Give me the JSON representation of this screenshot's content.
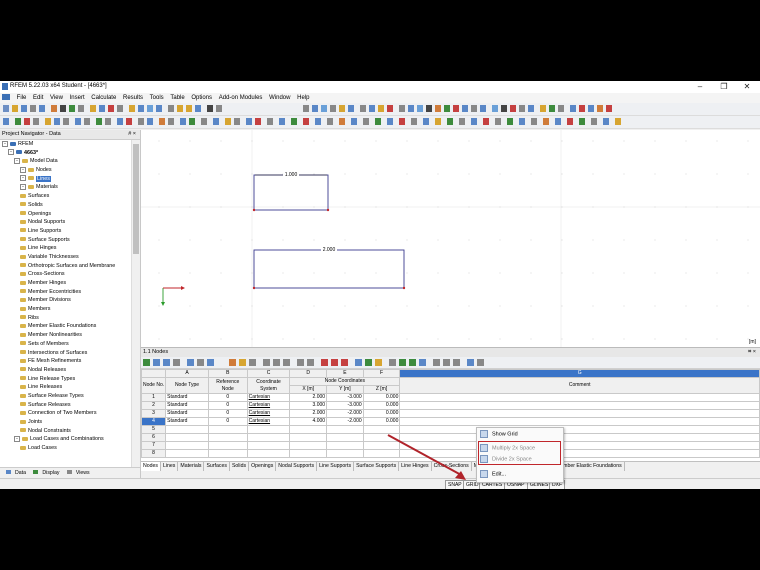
{
  "window": {
    "title": "RFEM 5.22.03 x64 Student - [4663*]",
    "controls": [
      "–",
      "❐",
      "✕"
    ]
  },
  "menu": [
    "File",
    "Edit",
    "View",
    "Insert",
    "Calculate",
    "Results",
    "Tools",
    "Table",
    "Options",
    "Add-on Modules",
    "Window",
    "Help"
  ],
  "navigator": {
    "title": "Project Navigator - Data",
    "close_symbols": "# ×",
    "items": [
      {
        "label": "RFEM",
        "indent": 0,
        "type": "root"
      },
      {
        "label": "4663*",
        "indent": 1,
        "type": "model",
        "bold": true
      },
      {
        "label": "Model Data",
        "indent": 2,
        "type": "folder-exp"
      },
      {
        "label": "Nodes",
        "indent": 3,
        "type": "folder-exp"
      },
      {
        "label": "Lines",
        "indent": 3,
        "type": "folder-exp",
        "selected": true
      },
      {
        "label": "Materials",
        "indent": 3,
        "type": "folder-exp"
      },
      {
        "label": "Surfaces",
        "indent": 3,
        "type": "folder"
      },
      {
        "label": "Solids",
        "indent": 3,
        "type": "folder"
      },
      {
        "label": "Openings",
        "indent": 3,
        "type": "folder"
      },
      {
        "label": "Nodal Supports",
        "indent": 3,
        "type": "folder"
      },
      {
        "label": "Line Supports",
        "indent": 3,
        "type": "folder"
      },
      {
        "label": "Surface Supports",
        "indent": 3,
        "type": "folder"
      },
      {
        "label": "Line Hinges",
        "indent": 3,
        "type": "folder"
      },
      {
        "label": "Variable Thicknesses",
        "indent": 3,
        "type": "folder"
      },
      {
        "label": "Orthotropic Surfaces and Membrane",
        "indent": 3,
        "type": "folder"
      },
      {
        "label": "Cross-Sections",
        "indent": 3,
        "type": "folder"
      },
      {
        "label": "Member Hinges",
        "indent": 3,
        "type": "folder"
      },
      {
        "label": "Member Eccentricities",
        "indent": 3,
        "type": "folder"
      },
      {
        "label": "Member Divisions",
        "indent": 3,
        "type": "folder"
      },
      {
        "label": "Members",
        "indent": 3,
        "type": "folder"
      },
      {
        "label": "Ribs",
        "indent": 3,
        "type": "folder"
      },
      {
        "label": "Member Elastic Foundations",
        "indent": 3,
        "type": "folder"
      },
      {
        "label": "Member Nonlinearities",
        "indent": 3,
        "type": "folder"
      },
      {
        "label": "Sets of Members",
        "indent": 3,
        "type": "folder"
      },
      {
        "label": "Intersections of Surfaces",
        "indent": 3,
        "type": "folder"
      },
      {
        "label": "FE Mesh Refinements",
        "indent": 3,
        "type": "folder"
      },
      {
        "label": "Nodal Releases",
        "indent": 3,
        "type": "folder"
      },
      {
        "label": "Line Release Types",
        "indent": 3,
        "type": "folder"
      },
      {
        "label": "Line Releases",
        "indent": 3,
        "type": "folder"
      },
      {
        "label": "Surface Release Types",
        "indent": 3,
        "type": "folder"
      },
      {
        "label": "Surface Releases",
        "indent": 3,
        "type": "folder"
      },
      {
        "label": "Connection of Two Members",
        "indent": 3,
        "type": "folder"
      },
      {
        "label": "Joints",
        "indent": 3,
        "type": "folder"
      },
      {
        "label": "Nodal Constraints",
        "indent": 3,
        "type": "folder"
      },
      {
        "label": "Load Cases and Combinations",
        "indent": 2,
        "type": "folder-exp"
      },
      {
        "label": "Load Cases",
        "indent": 3,
        "type": "folder"
      }
    ],
    "tabs": [
      "Data",
      "Display",
      "Views"
    ]
  },
  "canvas": {
    "label_top": "1.000",
    "label_bottom": "2.000",
    "corner": "[m]"
  },
  "table": {
    "title": "1.1 Nodes",
    "col_letters": [
      "A",
      "B",
      "C",
      "D",
      "E",
      "F",
      "G"
    ],
    "group_header": "Node Coordinates",
    "headers": [
      "Node No.",
      "Node Type",
      "Reference Node",
      "Coordinate System",
      "X [m]",
      "Y [m]",
      "Z [m]",
      "Comment"
    ],
    "rows": [
      [
        "1",
        "Standard",
        "0",
        "Cartesian",
        "2.000",
        "-3.000",
        "0.000",
        ""
      ],
      [
        "2",
        "Standard",
        "0",
        "Cartesian",
        "3.000",
        "-3.000",
        "0.000",
        ""
      ],
      [
        "3",
        "Standard",
        "0",
        "Cartesian",
        "2.000",
        "-2.000",
        "0.000",
        ""
      ],
      [
        "4",
        "Standard",
        "0",
        "Cartesian",
        "4.000",
        "-2.000",
        "0.000",
        ""
      ],
      [
        "5",
        "",
        "",
        "",
        "",
        "",
        "",
        ""
      ],
      [
        "6",
        "",
        "",
        "",
        "",
        "",
        "",
        ""
      ],
      [
        "7",
        "",
        "",
        "",
        "",
        "",
        "",
        ""
      ],
      [
        "8",
        "",
        "",
        "",
        "",
        "",
        "",
        ""
      ]
    ]
  },
  "sheet_tabs": [
    "Nodes",
    "Lines",
    "Materials",
    "Surfaces",
    "Solids",
    "Openings",
    "Nodal Supports",
    "Line Supports",
    "Surface Supports",
    "Line Hinges",
    "Cross-Sections",
    "M",
    "Member Divisions",
    "Members",
    "Member Elastic Foundations"
  ],
  "context_menu": {
    "items": [
      "Show Grid",
      "Multiply 2x Space",
      "Divide 2x Space",
      "Edit..."
    ]
  },
  "status": [
    "SNAP",
    "GRID",
    "CARTES",
    "OSNAP",
    "GLINES",
    "DXF"
  ],
  "colors": {
    "accent": "#3a74c8",
    "highlight_box": "#c0262b",
    "arrow": "#b0232a"
  }
}
